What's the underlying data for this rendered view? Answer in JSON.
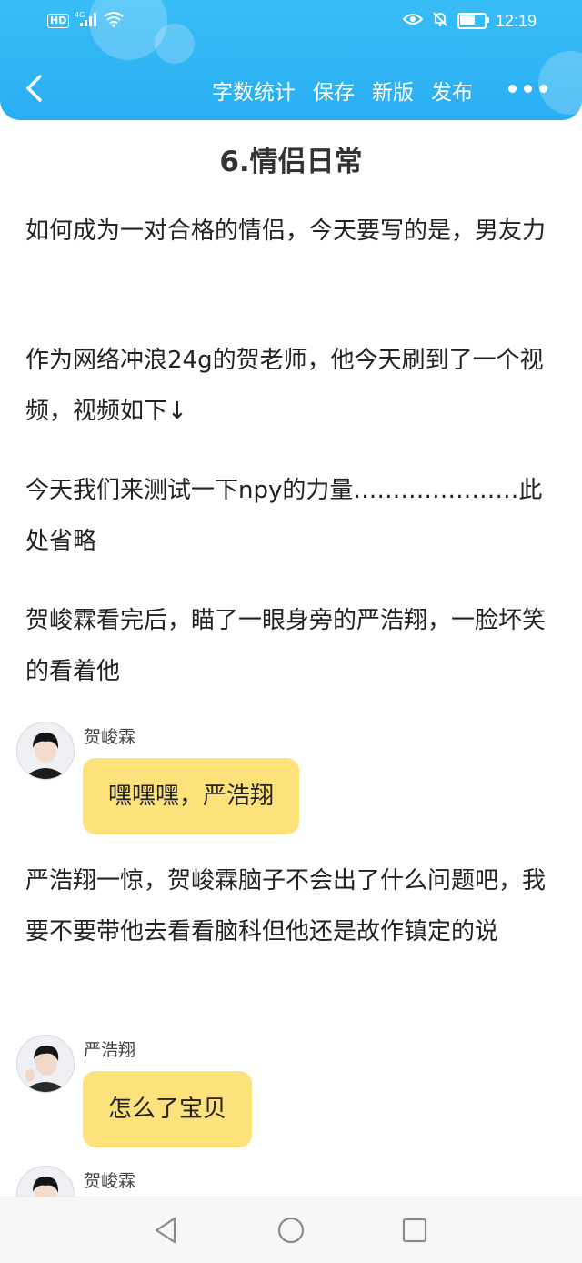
{
  "status_bar": {
    "hd_label": "HD",
    "network_label": "4G",
    "time": "12:19",
    "battery_level": 0.6
  },
  "toolbar": {
    "word_count_label": "字数统计",
    "save_label": "保存",
    "new_version_label": "新版",
    "publish_label": "发布"
  },
  "chapter": {
    "title": "6.情侣日常"
  },
  "content": {
    "para1": "如何成为一对合格的情侣，今天要写的是，男友力",
    "para2": "作为网络冲浪24g的贺老师，他今天刷到了一个视频，视频如下↓",
    "para3": "今天我们来测试一下npy的力量…………………此处省略",
    "para4": "贺峻霖看完后，瞄了一眼身旁的严浩翔，一脸坏笑的看着他",
    "para5": "严浩翔一惊，贺峻霖脑子不会出了什么问题吧，我要不要带他去看看脑科但他还是故作镇定的说"
  },
  "messages": [
    {
      "name": "贺峻霖",
      "text": "嘿嘿嘿，严浩翔"
    },
    {
      "name": "严浩翔",
      "text": "怎么了宝贝"
    },
    {
      "name": "贺峻霖",
      "text": ""
    }
  ],
  "colors": {
    "header": "#2aaef3",
    "bubble": "#fde17b"
  },
  "icons": {
    "back": "chevron-left-icon",
    "more": "more-dots-icon",
    "nav_back": "triangle-back-icon",
    "nav_home": "circle-home-icon",
    "nav_recent": "square-recent-icon"
  }
}
